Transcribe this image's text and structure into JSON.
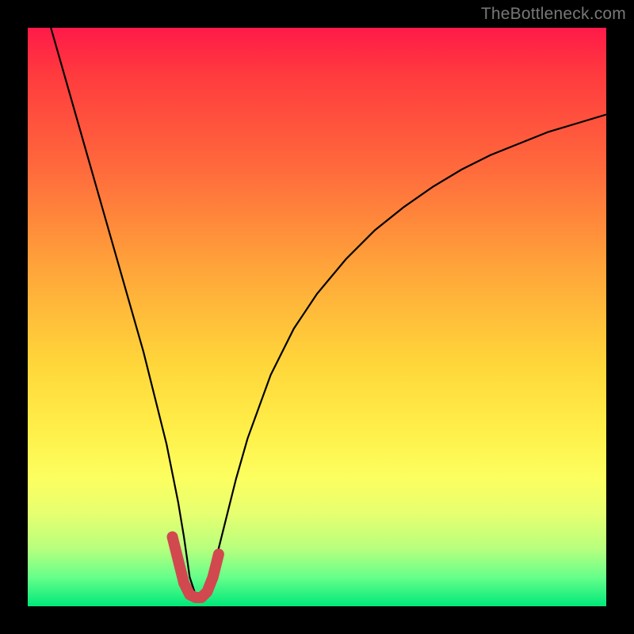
{
  "watermark": "TheBottleneck.com",
  "chart_data": {
    "type": "line",
    "title": "",
    "xlabel": "",
    "ylabel": "",
    "x_range": [
      0,
      100
    ],
    "y_range": [
      0,
      100
    ],
    "series": [
      {
        "name": "curve",
        "color": "#000000",
        "x": [
          4,
          6,
          8,
          10,
          12,
          14,
          16,
          18,
          20,
          22,
          24,
          26,
          27,
          28,
          29,
          30,
          31,
          32,
          34,
          36,
          38,
          42,
          46,
          50,
          55,
          60,
          65,
          70,
          75,
          80,
          85,
          90,
          95,
          100
        ],
        "y": [
          100,
          93,
          86,
          79,
          72,
          65,
          58,
          51,
          44,
          36,
          28,
          18,
          12,
          5,
          2,
          2,
          3,
          6,
          14,
          22,
          29,
          40,
          48,
          54,
          60,
          65,
          69,
          72.5,
          75.5,
          78,
          80,
          82,
          83.5,
          85
        ]
      },
      {
        "name": "bottom-highlight",
        "color": "#d1494f",
        "x": [
          25,
          26,
          27,
          28,
          29,
          30,
          31,
          32,
          33
        ],
        "y": [
          12,
          8,
          4,
          2,
          1.5,
          1.5,
          2.5,
          5,
          9
        ]
      }
    ]
  }
}
